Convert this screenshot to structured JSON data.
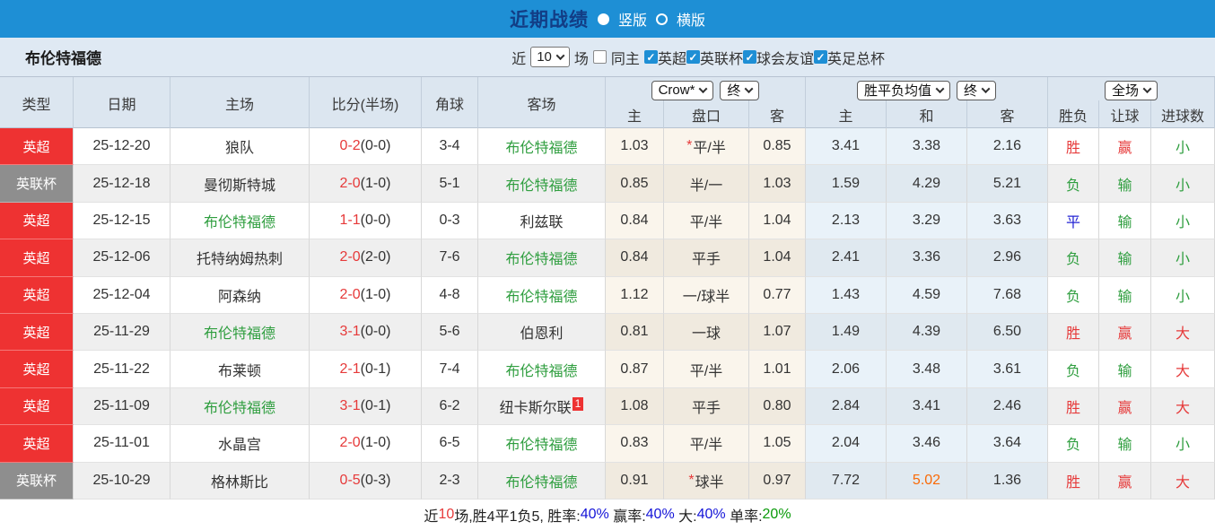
{
  "titlebar": {
    "title": "近期战绩",
    "radio_vertical": "竖版",
    "radio_horizontal": "横版"
  },
  "filter": {
    "team": "布伦特福德",
    "recent_label": "近",
    "recent_value": "10",
    "matches_label": "场",
    "same_home_label": "同主",
    "leagues": [
      {
        "label": "英超",
        "checked": true
      },
      {
        "label": "英联杯",
        "checked": true
      },
      {
        "label": "球会友谊",
        "checked": true
      },
      {
        "label": "英足总杯",
        "checked": true
      }
    ]
  },
  "colors": {
    "accent_blue": "#1e8fd5",
    "league_red": "#ee3232",
    "league_gray": "#8e8e8e",
    "win_red": "#e63a3a",
    "lose_green": "#2f9e3f",
    "draw_blue": "#2323d4",
    "highlight_orange": "#f96a07"
  },
  "table": {
    "left_headers": [
      "类型",
      "日期",
      "主场",
      "比分(半场)",
      "角球",
      "客场"
    ],
    "dropdowns": {
      "company": "Crow*",
      "company_final": "终",
      "avg": "胜平负均值",
      "avg_final": "终",
      "fulltime": "全场"
    },
    "sub_headers": [
      "主",
      "盘口",
      "客",
      "主",
      "和",
      "客",
      "胜负",
      "让球",
      "进球数"
    ],
    "rows": [
      {
        "type": "英超",
        "type_color": "red",
        "date": "25-12-20",
        "home": "狼队",
        "home_green": false,
        "score": "0-2",
        "half": "(0-0)",
        "corner": "3-4",
        "away": "布伦特福德",
        "away_green": true,
        "away_badge": "",
        "ah_home": "1.03",
        "handicap": "平/半",
        "handicap_star": true,
        "ah_away": "0.85",
        "odd_home": "3.41",
        "odd_draw": "3.38",
        "odd_away": "2.16",
        "draw_orange": false,
        "result": "胜",
        "result_color": "red",
        "let": "赢",
        "let_color": "red",
        "goal": "小",
        "goal_color": "green"
      },
      {
        "type": "英联杯",
        "type_color": "gray",
        "date": "25-12-18",
        "home": "曼彻斯特城",
        "home_green": false,
        "score": "2-0",
        "half": "(1-0)",
        "corner": "5-1",
        "away": "布伦特福德",
        "away_green": true,
        "away_badge": "",
        "ah_home": "0.85",
        "handicap": "半/一",
        "handicap_star": false,
        "ah_away": "1.03",
        "odd_home": "1.59",
        "odd_draw": "4.29",
        "odd_away": "5.21",
        "draw_orange": false,
        "result": "负",
        "result_color": "green",
        "let": "输",
        "let_color": "green",
        "goal": "小",
        "goal_color": "green"
      },
      {
        "type": "英超",
        "type_color": "red",
        "date": "25-12-15",
        "home": "布伦特福德",
        "home_green": true,
        "score": "1-1",
        "half": "(0-0)",
        "corner": "0-3",
        "away": "利兹联",
        "away_green": false,
        "away_badge": "",
        "ah_home": "0.84",
        "handicap": "平/半",
        "handicap_star": false,
        "ah_away": "1.04",
        "odd_home": "2.13",
        "odd_draw": "3.29",
        "odd_away": "3.63",
        "draw_orange": false,
        "result": "平",
        "result_color": "blue",
        "let": "输",
        "let_color": "green",
        "goal": "小",
        "goal_color": "green"
      },
      {
        "type": "英超",
        "type_color": "red",
        "date": "25-12-06",
        "home": "托特纳姆热刺",
        "home_green": false,
        "score": "2-0",
        "half": "(2-0)",
        "corner": "7-6",
        "away": "布伦特福德",
        "away_green": true,
        "away_badge": "",
        "ah_home": "0.84",
        "handicap": "平手",
        "handicap_star": false,
        "ah_away": "1.04",
        "odd_home": "2.41",
        "odd_draw": "3.36",
        "odd_away": "2.96",
        "draw_orange": false,
        "result": "负",
        "result_color": "green",
        "let": "输",
        "let_color": "green",
        "goal": "小",
        "goal_color": "green"
      },
      {
        "type": "英超",
        "type_color": "red",
        "date": "25-12-04",
        "home": "阿森纳",
        "home_green": false,
        "score": "2-0",
        "half": "(1-0)",
        "corner": "4-8",
        "away": "布伦特福德",
        "away_green": true,
        "away_badge": "",
        "ah_home": "1.12",
        "handicap": "一/球半",
        "handicap_star": false,
        "ah_away": "0.77",
        "odd_home": "1.43",
        "odd_draw": "4.59",
        "odd_away": "7.68",
        "draw_orange": false,
        "result": "负",
        "result_color": "green",
        "let": "输",
        "let_color": "green",
        "goal": "小",
        "goal_color": "green"
      },
      {
        "type": "英超",
        "type_color": "red",
        "date": "25-11-29",
        "home": "布伦特福德",
        "home_green": true,
        "score": "3-1",
        "half": "(0-0)",
        "corner": "5-6",
        "away": "伯恩利",
        "away_green": false,
        "away_badge": "",
        "ah_home": "0.81",
        "handicap": "一球",
        "handicap_star": false,
        "ah_away": "1.07",
        "odd_home": "1.49",
        "odd_draw": "4.39",
        "odd_away": "6.50",
        "draw_orange": false,
        "result": "胜",
        "result_color": "red",
        "let": "赢",
        "let_color": "red",
        "goal": "大",
        "goal_color": "red"
      },
      {
        "type": "英超",
        "type_color": "red",
        "date": "25-11-22",
        "home": "布莱顿",
        "home_green": false,
        "score": "2-1",
        "half": "(0-1)",
        "corner": "7-4",
        "away": "布伦特福德",
        "away_green": true,
        "away_badge": "",
        "ah_home": "0.87",
        "handicap": "平/半",
        "handicap_star": false,
        "ah_away": "1.01",
        "odd_home": "2.06",
        "odd_draw": "3.48",
        "odd_away": "3.61",
        "draw_orange": false,
        "result": "负",
        "result_color": "green",
        "let": "输",
        "let_color": "green",
        "goal": "大",
        "goal_color": "red"
      },
      {
        "type": "英超",
        "type_color": "red",
        "date": "25-11-09",
        "home": "布伦特福德",
        "home_green": true,
        "score": "3-1",
        "half": "(0-1)",
        "corner": "6-2",
        "away": "纽卡斯尔联",
        "away_green": false,
        "away_badge": "1",
        "ah_home": "1.08",
        "handicap": "平手",
        "handicap_star": false,
        "ah_away": "0.80",
        "odd_home": "2.84",
        "odd_draw": "3.41",
        "odd_away": "2.46",
        "draw_orange": false,
        "result": "胜",
        "result_color": "red",
        "let": "赢",
        "let_color": "red",
        "goal": "大",
        "goal_color": "red"
      },
      {
        "type": "英超",
        "type_color": "red",
        "date": "25-11-01",
        "home": "水晶宫",
        "home_green": false,
        "score": "2-0",
        "half": "(1-0)",
        "corner": "6-5",
        "away": "布伦特福德",
        "away_green": true,
        "away_badge": "",
        "ah_home": "0.83",
        "handicap": "平/半",
        "handicap_star": false,
        "ah_away": "1.05",
        "odd_home": "2.04",
        "odd_draw": "3.46",
        "odd_away": "3.64",
        "draw_orange": false,
        "result": "负",
        "result_color": "green",
        "let": "输",
        "let_color": "green",
        "goal": "小",
        "goal_color": "green"
      },
      {
        "type": "英联杯",
        "type_color": "gray",
        "date": "25-10-29",
        "home": "格林斯比",
        "home_green": false,
        "score": "0-5",
        "half": "(0-3)",
        "corner": "2-3",
        "away": "布伦特福德",
        "away_green": true,
        "away_badge": "",
        "ah_home": "0.91",
        "handicap": "球半",
        "handicap_star": true,
        "ah_away": "0.97",
        "odd_home": "7.72",
        "odd_draw": "5.02",
        "odd_away": "1.36",
        "draw_orange": true,
        "result": "胜",
        "result_color": "red",
        "let": "赢",
        "let_color": "red",
        "goal": "大",
        "goal_color": "red"
      }
    ]
  },
  "summary": [
    {
      "text": "近",
      "color": "black"
    },
    {
      "text": "10",
      "color": "red"
    },
    {
      "text": "场,胜4平1负5, 胜率:",
      "color": "black"
    },
    {
      "text": "40%",
      "color": "blue"
    },
    {
      "text": " 赢率:",
      "color": "black"
    },
    {
      "text": "40%",
      "color": "blue"
    },
    {
      "text": " 大:",
      "color": "black"
    },
    {
      "text": "40%",
      "color": "blue"
    },
    {
      "text": " 单率:",
      "color": "black"
    },
    {
      "text": "20%",
      "color": "green"
    }
  ]
}
